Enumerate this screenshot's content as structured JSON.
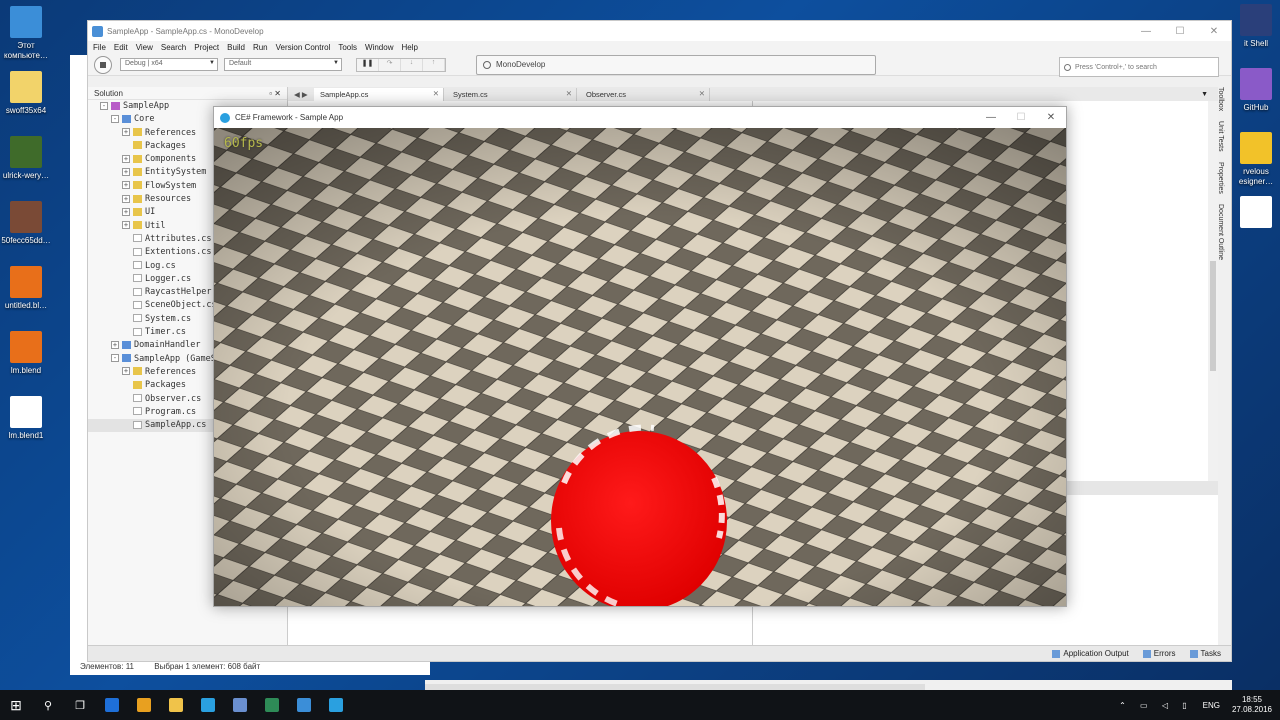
{
  "desktop": {
    "left_icons": [
      {
        "label": "Этот компьюте…",
        "color": "#3b8ed8"
      },
      {
        "label": "swoff35x64",
        "color": "#f2d36a"
      },
      {
        "label": "ulrick-wery…",
        "color": "#3f6b2a"
      },
      {
        "label": "50fecc65dd…",
        "color": "#7a4a36"
      },
      {
        "label": "untitled.bl…",
        "color": "#e86f1a"
      },
      {
        "label": "lm.blend",
        "color": "#e86f1a"
      },
      {
        "label": "lm.blend1",
        "color": "#ffffff"
      }
    ],
    "right_icons": [
      {
        "label": "it Shell",
        "color": "#2a3f7a"
      },
      {
        "label": "GitHub",
        "color": "#8a5ac8"
      },
      {
        "label": "rvelous esigner…",
        "color": "#f2c229"
      },
      {
        "label": "",
        "color": "#ffffff"
      }
    ]
  },
  "explorer": {
    "status_items": "Элементов: 11",
    "status_selected": "Выбран 1 элемент: 608 байт"
  },
  "monodevelop": {
    "title": "SampleApp - SampleApp.cs - MonoDevelop",
    "menu": [
      "File",
      "Edit",
      "View",
      "Search",
      "Project",
      "Build",
      "Run",
      "Version Control",
      "Tools",
      "Window",
      "Help"
    ],
    "config": "Debug | x64",
    "target": "Default",
    "status_text": "MonoDevelop",
    "search_placeholder": "Press 'Control+,' to search",
    "solution_title": "Solution",
    "tree": [
      {
        "label": "SampleApp",
        "indent": 0,
        "icon": "sol",
        "exp": "-"
      },
      {
        "label": "Core",
        "indent": 1,
        "icon": "proj",
        "exp": "-"
      },
      {
        "label": "References",
        "indent": 2,
        "icon": "folder",
        "exp": "+"
      },
      {
        "label": "Packages",
        "indent": 2,
        "icon": "folder",
        "exp": ""
      },
      {
        "label": "Components",
        "indent": 2,
        "icon": "folder",
        "exp": "+"
      },
      {
        "label": "EntitySystem",
        "indent": 2,
        "icon": "folder",
        "exp": "+"
      },
      {
        "label": "FlowSystem",
        "indent": 2,
        "icon": "folder",
        "exp": "+"
      },
      {
        "label": "Resources",
        "indent": 2,
        "icon": "folder",
        "exp": "+"
      },
      {
        "label": "UI",
        "indent": 2,
        "icon": "folder",
        "exp": "+"
      },
      {
        "label": "Util",
        "indent": 2,
        "icon": "folder",
        "exp": "+"
      },
      {
        "label": "Attributes.cs",
        "indent": 2,
        "icon": "file",
        "exp": ""
      },
      {
        "label": "Extentions.cs",
        "indent": 2,
        "icon": "file",
        "exp": ""
      },
      {
        "label": "Log.cs",
        "indent": 2,
        "icon": "file",
        "exp": ""
      },
      {
        "label": "Logger.cs",
        "indent": 2,
        "icon": "file",
        "exp": ""
      },
      {
        "label": "RaycastHelper.c",
        "indent": 2,
        "icon": "file",
        "exp": ""
      },
      {
        "label": "SceneObject.cs",
        "indent": 2,
        "icon": "file",
        "exp": ""
      },
      {
        "label": "System.cs",
        "indent": 2,
        "icon": "file",
        "exp": ""
      },
      {
        "label": "Timer.cs",
        "indent": 2,
        "icon": "file",
        "exp": ""
      },
      {
        "label": "DomainHandler",
        "indent": 1,
        "icon": "proj",
        "exp": "+"
      },
      {
        "label": "SampleApp (GameSD",
        "indent": 1,
        "icon": "proj",
        "exp": "-"
      },
      {
        "label": "References",
        "indent": 2,
        "icon": "folder",
        "exp": "+"
      },
      {
        "label": "Packages",
        "indent": 2,
        "icon": "folder",
        "exp": ""
      },
      {
        "label": "Observer.cs",
        "indent": 2,
        "icon": "file",
        "exp": ""
      },
      {
        "label": "Program.cs",
        "indent": 2,
        "icon": "file",
        "exp": ""
      },
      {
        "label": "SampleApp.cs",
        "indent": 2,
        "icon": "file",
        "exp": "",
        "selected": true
      }
    ],
    "tabs": [
      {
        "label": "SampleApp.cs",
        "active": true
      },
      {
        "label": "System.cs",
        "active": false
      },
      {
        "label": "Observer.cs",
        "active": false
      }
    ],
    "side_pads": [
      "Toolbox",
      "Unit Tests",
      "Properties",
      "Document Outline"
    ],
    "bottom_pads": [
      "Application Output",
      "Errors",
      "Tasks"
    ]
  },
  "game": {
    "title": "CE# Framework - Sample App",
    "fps": "60fps"
  },
  "taskbar": {
    "apps": [
      "#1e6fd8",
      "#e8a020",
      "#f0c34a",
      "#2aa0e0",
      "#6a8fd0",
      "#2e8b57",
      "#3b8ed8",
      "#2aa0e0"
    ],
    "lang": "ENG",
    "time": "18:55",
    "date": "27.08.2016"
  }
}
